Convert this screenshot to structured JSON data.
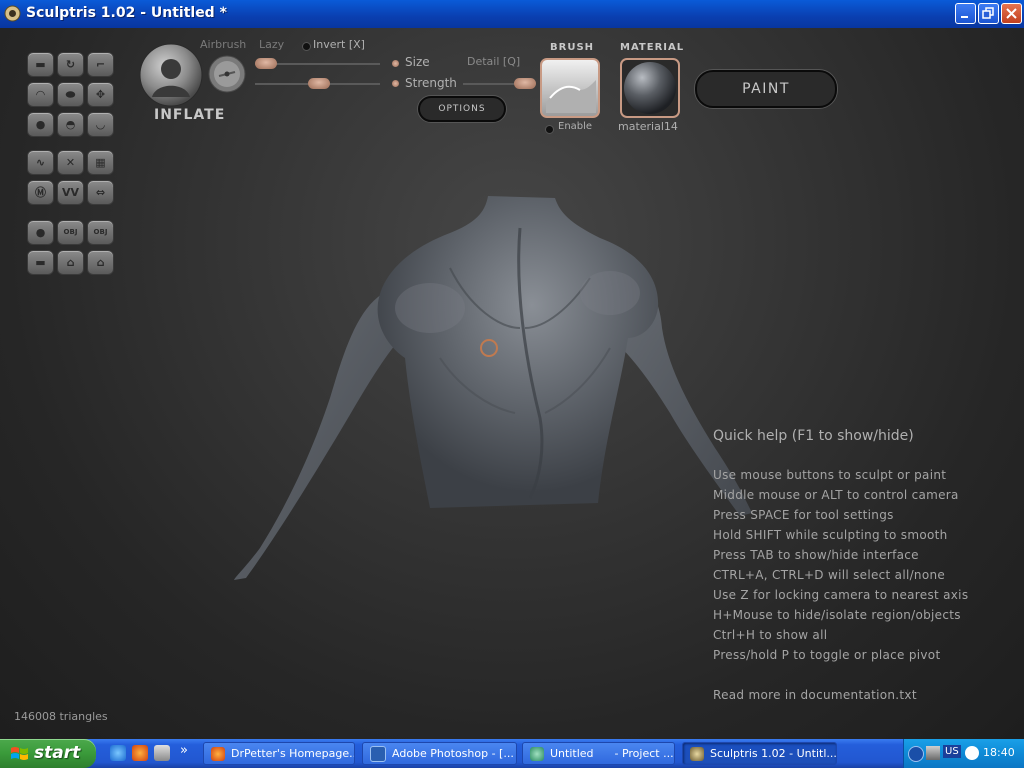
{
  "window": {
    "title": "Sculptris 1.02 - Untitled *"
  },
  "brush_panel": {
    "tool_name": "INFLATE",
    "airbrush_label": "Airbrush",
    "lazy_label": "Lazy",
    "invert_label": "Invert [X]",
    "size_label": "Size",
    "strength_label": "Strength",
    "detail_label": "Detail [Q]",
    "options_label": "OPTIONS"
  },
  "brush_texture": {
    "heading": "BRUSH",
    "enable_label": "Enable"
  },
  "material": {
    "heading": "MATERIAL",
    "name": "material14"
  },
  "paint_button": {
    "label": "PAINT"
  },
  "tool_grid": {
    "icons": [
      "flatten-icon",
      "rotate-icon",
      "crop-icon",
      "crease-icon",
      "pinch-icon",
      "grab-icon",
      "draw-icon",
      "inflate-icon",
      "smooth-icon",
      "symmetry-icon",
      "wireframe-icon",
      "grid-icon",
      "mirror-icon",
      "reduce-icon",
      "flip-icon",
      "sphere-icon",
      "import-obj-icon",
      "export-obj-icon",
      "plane-icon",
      "save-icon",
      "save-as-icon"
    ],
    "obj_text": "OBJ"
  },
  "quick_help": {
    "title": "Quick help (F1 to show/hide)",
    "lines": [
      "Use mouse buttons to sculpt or paint",
      "Middle mouse or ALT to control camera",
      "Press SPACE for tool settings",
      "Hold SHIFT while sculpting to smooth",
      "Press TAB to show/hide interface",
      "CTRL+A, CTRL+D will select all/none",
      "Use Z for locking camera to nearest axis",
      "H+Mouse to hide/isolate region/objects",
      "Ctrl+H to show all",
      "Press/hold P to toggle or place pivot"
    ],
    "footer": "Read more in documentation.txt"
  },
  "status": {
    "triangles": "146008 triangles"
  },
  "taskbar": {
    "start_label": "start",
    "overflow_glyph": "»",
    "items": [
      {
        "label": "DrPetter's Homepage...",
        "icon": "firefox-icon"
      },
      {
        "label": "Adobe Photoshop - [...",
        "icon": "photoshop-icon"
      },
      {
        "label": "Untitled      - Project ...",
        "icon": "project-icon"
      },
      {
        "label": "Sculptris 1.02 - Untitl...",
        "icon": "sculptris-icon"
      }
    ],
    "tray": {
      "language": "US",
      "time": "18:40"
    }
  },
  "colors": {
    "titlebar": "#0a4fc8",
    "taskbar": "#245edb",
    "start": "#3a9a3a",
    "accent_knob": "#c89a84",
    "viewport": "#363636"
  }
}
